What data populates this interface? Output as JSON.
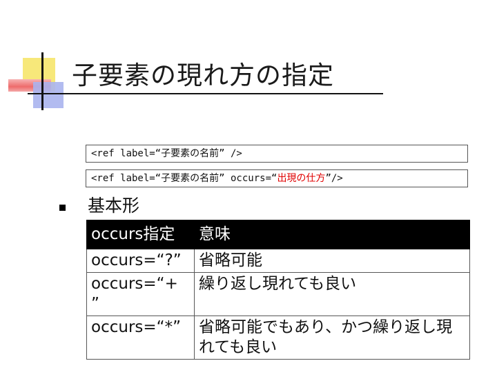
{
  "slide": {
    "title": "子要素の現れ方の指定",
    "code_lines": [
      {
        "before": "<ref label=“子要素の名前” />",
        "highlight": "",
        "after": ""
      },
      {
        "before": "<ref label=“子要素の名前” occurs=“",
        "highlight": "出現の仕方",
        "after": "”/>"
      }
    ],
    "bullet": "基本形",
    "table": {
      "headers": [
        "occurs指定",
        "意味"
      ],
      "rows": [
        [
          "occurs=“?”",
          "省略可能"
        ],
        [
          "occurs=“+ ”",
          "繰り返し現れても良い"
        ],
        [
          "occurs=“*”",
          "省略可能でもあり、かつ繰り返し現れても良い"
        ]
      ]
    },
    "colors": {
      "highlight": "#e00000",
      "table_header_bg": "#000000"
    }
  }
}
